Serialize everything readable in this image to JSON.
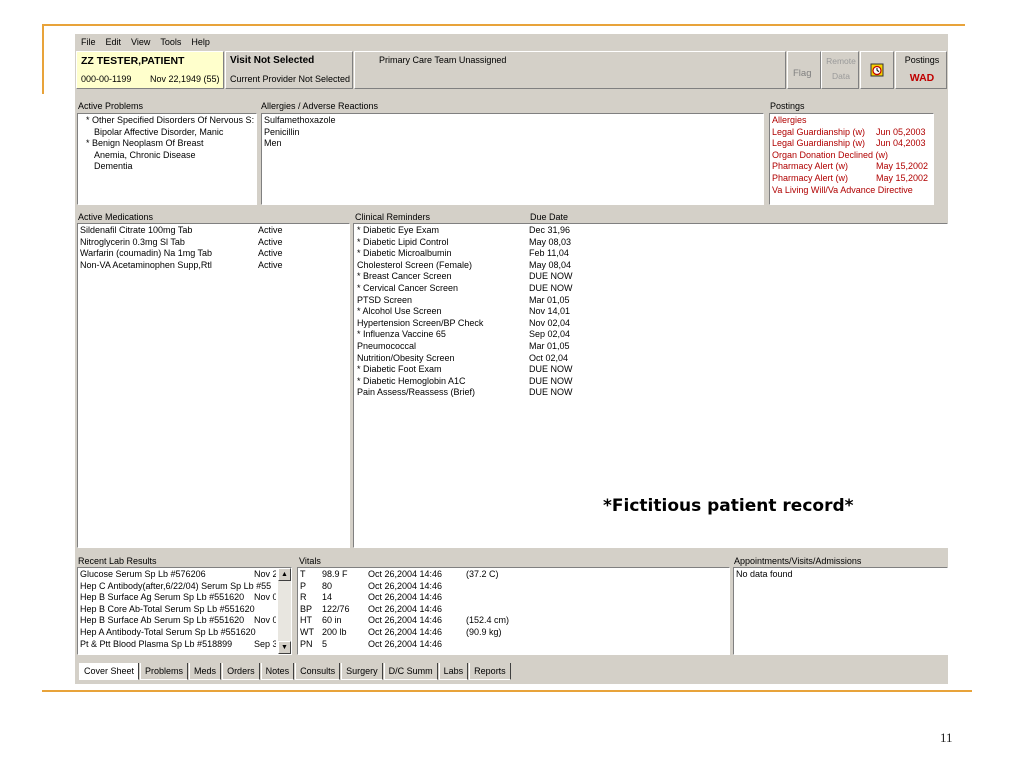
{
  "menu": [
    "File",
    "Edit",
    "View",
    "Tools",
    "Help"
  ],
  "patient": {
    "name": "ZZ TESTER,PATIENT",
    "ssn": "000-00-1199",
    "dob": "Nov 22,1949 (55)"
  },
  "visit": {
    "title": "Visit Not Selected",
    "provider": "Current Provider Not Selected"
  },
  "team": "Primary Care Team Unassigned",
  "flag": "Flag",
  "remote": "Remote\nData",
  "postings_button": {
    "label": "Postings",
    "code": "WAD"
  },
  "problems": {
    "label": "Active Problems",
    "items": [
      "* Other Specified Disorders Of Nervous S:",
      "Bipolar Affective Disorder, Manic",
      "* Benign Neoplasm Of Breast",
      "Anemia, Chronic Disease",
      "Dementia"
    ]
  },
  "allergies": {
    "label": "Allergies / Adverse Reactions",
    "items": [
      "Sulfamethoxazole",
      "Penicillin",
      "Men"
    ]
  },
  "postings": {
    "label": "Postings",
    "items": [
      {
        "name": "Allergies",
        "date": ""
      },
      {
        "name": "Legal Guardianship (w)",
        "date": "Jun 05,2003"
      },
      {
        "name": "Legal Guardianship (w)",
        "date": "Jun 04,2003"
      },
      {
        "name": "Organ Donation Declined (w)",
        "date": ""
      },
      {
        "name": "Pharmacy Alert (w)",
        "date": "May 15,2002"
      },
      {
        "name": "Pharmacy Alert (w)",
        "date": "May 15,2002"
      },
      {
        "name": "Va Living Will/Va Advance Directive",
        "date": ""
      }
    ]
  },
  "medications": {
    "label": "Active Medications",
    "items": [
      {
        "name": "Sildenafil Citrate 100mg Tab",
        "status": "Active"
      },
      {
        "name": "Nitroglycerin 0.3mg Sl Tab",
        "status": "Active"
      },
      {
        "name": "Warfarin (coumadin) Na 1mg Tab",
        "status": "Active"
      },
      {
        "name": "Non-VA  Acetaminophen Supp,Rtl",
        "status": "Active"
      }
    ]
  },
  "reminders": {
    "label": "Clinical Reminders",
    "due_label": "Due Date",
    "items": [
      {
        "name": "* Diabetic Eye Exam",
        "due": "Dec 31,96"
      },
      {
        "name": "* Diabetic Lipid Control",
        "due": "May 08,03"
      },
      {
        "name": "* Diabetic Microalbumin",
        "due": "Feb 11,04"
      },
      {
        "name": "Cholesterol Screen (Female)",
        "due": "May 08,04"
      },
      {
        "name": "* Breast Cancer Screen",
        "due": "DUE NOW"
      },
      {
        "name": "* Cervical Cancer Screen",
        "due": "DUE NOW"
      },
      {
        "name": "PTSD Screen",
        "due": "Mar 01,05"
      },
      {
        "name": "* Alcohol Use Screen",
        "due": "Nov 14,01"
      },
      {
        "name": "Hypertension Screen/BP Check",
        "due": "Nov 02,04"
      },
      {
        "name": "* Influenza Vaccine 65",
        "due": "Sep 02,04"
      },
      {
        "name": "Pneumococcal",
        "due": "Mar 01,05"
      },
      {
        "name": "Nutrition/Obesity Screen",
        "due": "Oct 02,04"
      },
      {
        "name": "* Diabetic Foot Exam",
        "due": "DUE NOW"
      },
      {
        "name": "* Diabetic Hemoglobin A1C",
        "due": "DUE NOW"
      },
      {
        "name": "Pain Assess/Reassess (Brief)",
        "due": "DUE NOW"
      }
    ]
  },
  "fictitious_note": "*Fictitious patient record*",
  "labs": {
    "label": "Recent Lab Results",
    "items": [
      {
        "name": "Glucose Serum Sp Lb #576206",
        "date": "Nov 2"
      },
      {
        "name": "Hep C Antibody(after,6/22/04) Serum Sp Lb #55",
        "date": ""
      },
      {
        "name": "Hep B Surface Ag Serum Sp Lb #551620",
        "date": "Nov 0"
      },
      {
        "name": "Hep B Core Ab-Total Serum Sp Lb #551620",
        "date": ""
      },
      {
        "name": "Hep B Surface Ab Serum Sp Lb #551620",
        "date": "Nov 0"
      },
      {
        "name": "Hep A Antibody-Total Serum Sp Lb #551620",
        "date": ""
      },
      {
        "name": "Pt & Ptt Blood  Plasma Sp Lb #518899",
        "date": "Sep 3"
      }
    ]
  },
  "vitals": {
    "label": "Vitals",
    "items": [
      {
        "code": "T",
        "value": "98.9 F",
        "date": "Oct 26,2004 14:46",
        "alt": "(37.2 C)"
      },
      {
        "code": "P",
        "value": "80",
        "date": "Oct 26,2004 14:46",
        "alt": ""
      },
      {
        "code": "R",
        "value": "14",
        "date": "Oct 26,2004 14:46",
        "alt": ""
      },
      {
        "code": "BP",
        "value": "122/76",
        "date": "Oct 26,2004 14:46",
        "alt": ""
      },
      {
        "code": "HT",
        "value": "60 in",
        "date": "Oct 26,2004 14:46",
        "alt": "(152.4 cm)"
      },
      {
        "code": "WT",
        "value": "200 lb",
        "date": "Oct 26,2004 14:46",
        "alt": "(90.9 kg)"
      },
      {
        "code": "PN",
        "value": "5",
        "date": "Oct 26,2004 14:46",
        "alt": ""
      }
    ]
  },
  "appointments": {
    "label": "Appointments/Visits/Admissions",
    "empty": "No data found"
  },
  "tabs": [
    "Cover Sheet",
    "Problems",
    "Meds",
    "Orders",
    "Notes",
    "Consults",
    "Surgery",
    "D/C Summ",
    "Labs",
    "Reports"
  ],
  "page_number": "11",
  "colors": {
    "accent_line": "#e8a33a",
    "posting_text": "#b00000",
    "patient_bg": "#ffffcc"
  }
}
